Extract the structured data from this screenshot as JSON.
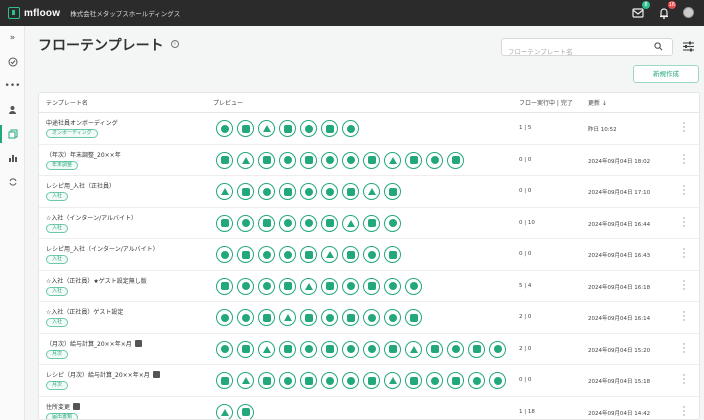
{
  "topbar": {
    "logo_text": "mfloow",
    "company": "株式会社メタップスホールディングス",
    "mail_badge": "8",
    "bell_badge": "16"
  },
  "colors": {
    "accent": "#23a87c",
    "topbar": "#2b2b2b"
  },
  "sidebar": {
    "items": [
      {
        "name": "expand",
        "icon": "chevron-double-right-icon"
      },
      {
        "name": "check",
        "icon": "check-circle-icon"
      },
      {
        "name": "more",
        "icon": "dots-icon"
      },
      {
        "name": "users",
        "icon": "users-icon"
      },
      {
        "name": "templates",
        "icon": "copy-icon",
        "active": true
      },
      {
        "name": "analytics",
        "icon": "bar-chart-icon"
      },
      {
        "name": "sync",
        "icon": "sync-icon"
      }
    ]
  },
  "page": {
    "title": "フローテンプレート",
    "search_placeholder": "フローテンプレート名",
    "new_button": "新規作成"
  },
  "table": {
    "headers": {
      "name": "テンプレート名",
      "preview": "プレビュー",
      "count": "フロー実行中 | 完了",
      "date": "更新 ↓"
    },
    "rows": [
      {
        "name": "中途社員オンボーディング",
        "tag": "オンボーディング",
        "icons": 7,
        "count": "1 | 5",
        "date": "昨日 10:52"
      },
      {
        "name": "（年次）年末調整_20××年",
        "tag": "年末調整",
        "icons": 12,
        "count": "0 | 0",
        "date": "2024年09月04日 18:02"
      },
      {
        "name": "レシピ用_入社（正社員）",
        "tag": "入社",
        "icons": 9,
        "count": "0 | 0",
        "date": "2024年09月04日 17:10"
      },
      {
        "name": "☆入社（インターン/アルバイト）",
        "tag": "入社",
        "icons": 9,
        "count": "0 | 10",
        "date": "2024年09月04日 16:44"
      },
      {
        "name": "レシピ用_入社（インターン/アルバイト）",
        "tag": "入社",
        "icons": 9,
        "count": "0 | 0",
        "date": "2024年09月04日 16:43"
      },
      {
        "name": "☆入社（正社員）★ゲスト設定無し版",
        "tag": "入社",
        "icons": 10,
        "count": "5 | 4",
        "date": "2024年09月04日 16:18"
      },
      {
        "name": "☆入社（正社員）ゲスト設定",
        "tag": "入社",
        "icons": 10,
        "count": "2 | 0",
        "date": "2024年09月04日 16:14"
      },
      {
        "name": "（月次）給与計算_20××年×月",
        "tag": "月次",
        "lock": true,
        "icons": 14,
        "count": "2 | 0",
        "date": "2024年09月04日 15:20"
      },
      {
        "name": "レシピ（月次）給与計算_20××年×月",
        "tag": "月次",
        "lock": true,
        "icons": 14,
        "count": "0 | 0",
        "date": "2024年09月04日 15:18"
      },
      {
        "name": "住所変更",
        "tag": "届出書類",
        "lock": true,
        "icons": 2,
        "count": "1 | 18",
        "date": "2024年09月04日 14:42"
      }
    ]
  }
}
